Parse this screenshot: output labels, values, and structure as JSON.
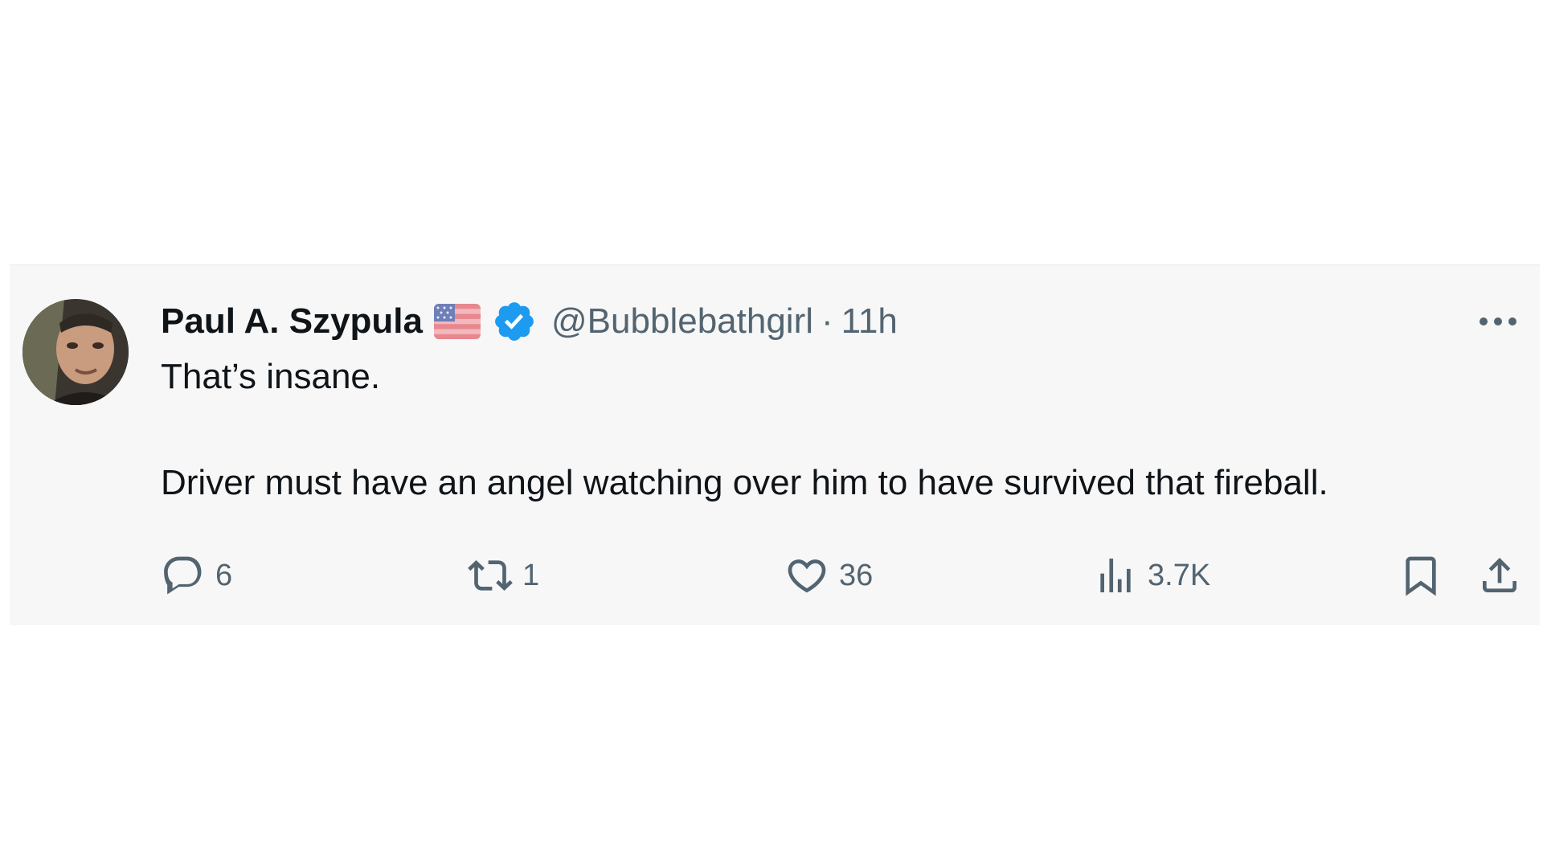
{
  "tweet": {
    "author": {
      "display_name": "Paul A. Szypula",
      "handle": "@Bubblebathgirl",
      "flag_icon": "us-flag-icon",
      "verified_icon": "verified-badge-icon"
    },
    "separator": "·",
    "timestamp": "11h",
    "text": {
      "line1": "That’s insane.",
      "line2": "Driver must have an angel watching over him to have survived that fireball."
    },
    "actions": {
      "reply": {
        "icon": "reply-icon",
        "count": "6"
      },
      "retweet": {
        "icon": "retweet-icon",
        "count": "1"
      },
      "like": {
        "icon": "heart-icon",
        "count": "36"
      },
      "views": {
        "icon": "views-icon",
        "count": "3.7K"
      },
      "bookmark": {
        "icon": "bookmark-icon"
      },
      "share": {
        "icon": "share-icon"
      }
    },
    "more_icon": "more-options-icon"
  },
  "colors": {
    "background": "#f7f7f7",
    "primary_text": "#0f1419",
    "secondary_text": "#536471",
    "verified_blue": "#1d9bf0"
  }
}
